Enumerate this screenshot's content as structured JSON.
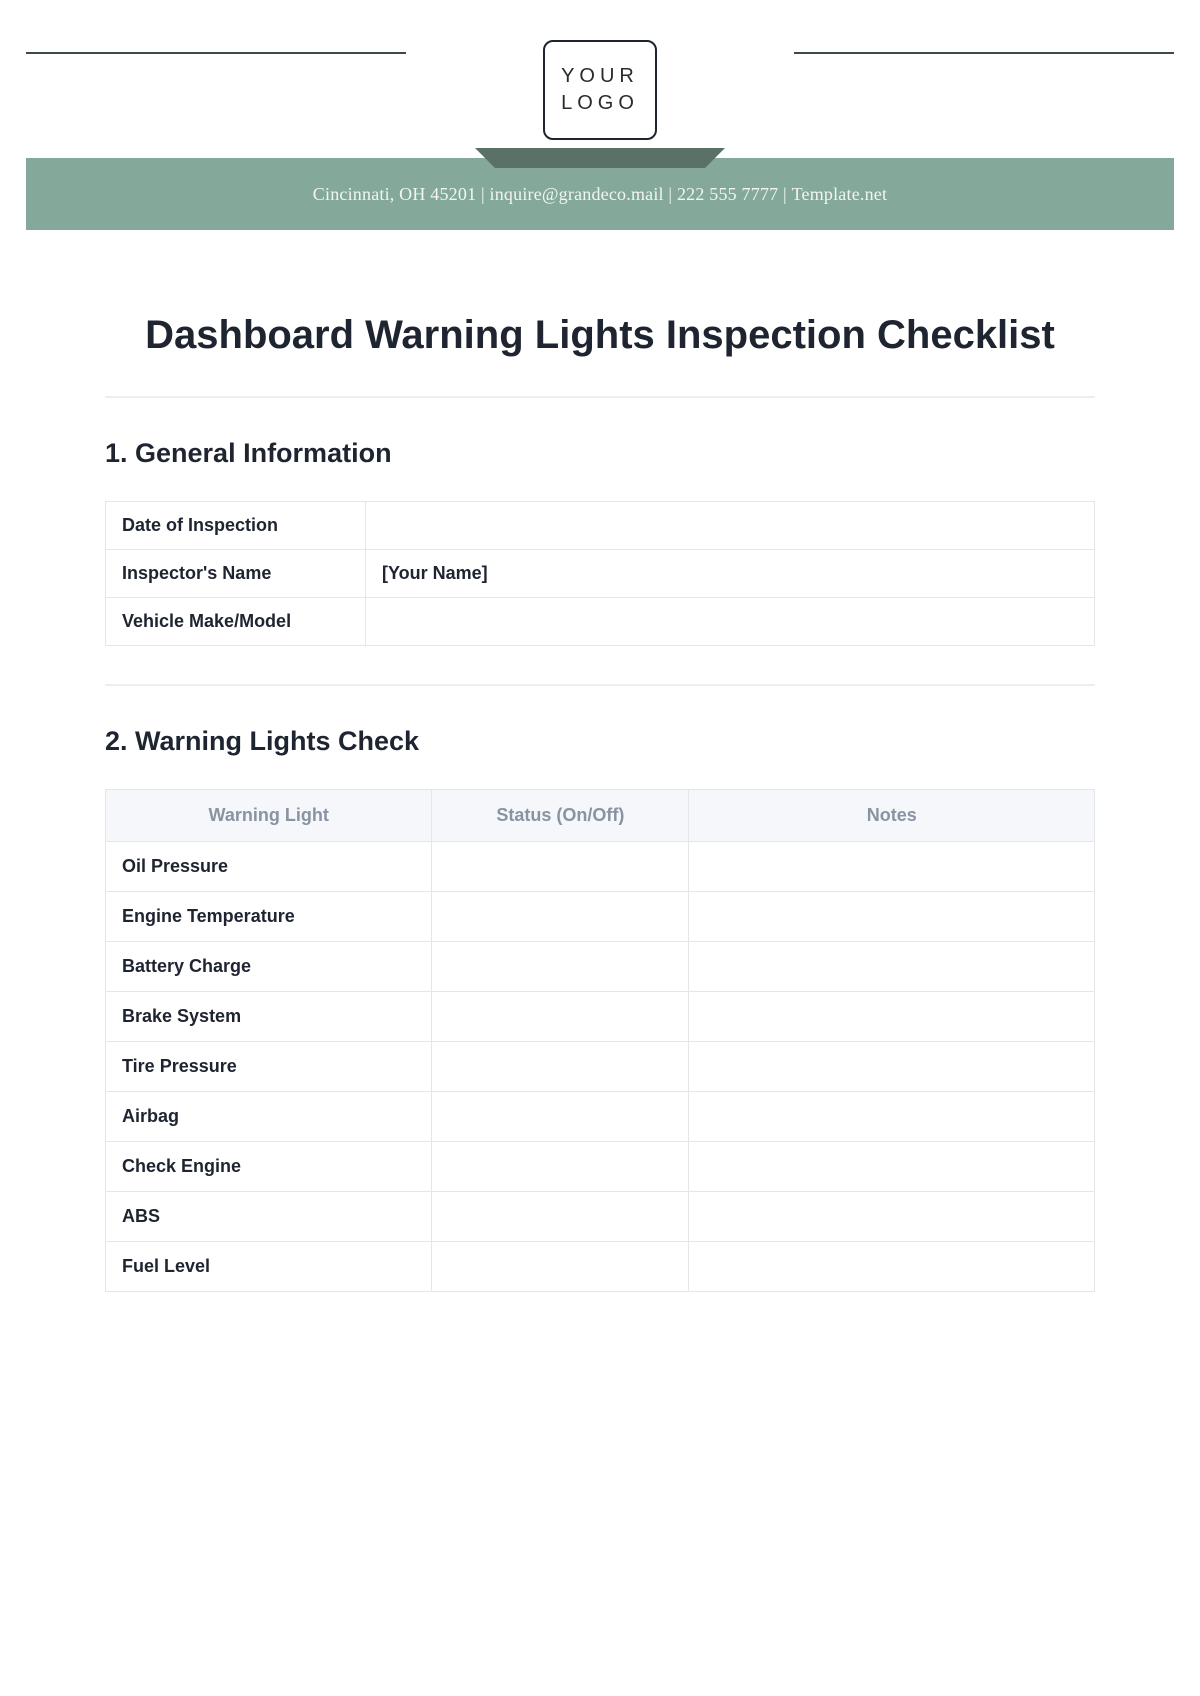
{
  "logo": {
    "line1": "YOUR",
    "line2": "LOGO"
  },
  "banner": {
    "address": "Cincinnati, OH 45201",
    "email": "inquire@grandeco.mail",
    "phone": "222 555 7777",
    "site": "Template.net",
    "sep": "  |  "
  },
  "title": "Dashboard Warning Lights Inspection Checklist",
  "section1": {
    "heading": "1. General Information",
    "rows": [
      {
        "label": "Date of Inspection",
        "value": ""
      },
      {
        "label": "Inspector's Name",
        "value": "[Your Name]"
      },
      {
        "label": "Vehicle Make/Model",
        "value": ""
      }
    ]
  },
  "section2": {
    "heading": "2. Warning Lights Check",
    "headers": [
      "Warning Light",
      "Status (On/Off)",
      "Notes"
    ],
    "rows": [
      {
        "name": "Oil Pressure",
        "status": "",
        "notes": ""
      },
      {
        "name": "Engine Temperature",
        "status": "",
        "notes": ""
      },
      {
        "name": "Battery Charge",
        "status": "",
        "notes": ""
      },
      {
        "name": "Brake System",
        "status": "",
        "notes": ""
      },
      {
        "name": "Tire Pressure",
        "status": "",
        "notes": ""
      },
      {
        "name": "Airbag",
        "status": "",
        "notes": ""
      },
      {
        "name": "Check Engine",
        "status": "",
        "notes": ""
      },
      {
        "name": "ABS",
        "status": "",
        "notes": ""
      },
      {
        "name": "Fuel Level",
        "status": "",
        "notes": ""
      }
    ]
  }
}
